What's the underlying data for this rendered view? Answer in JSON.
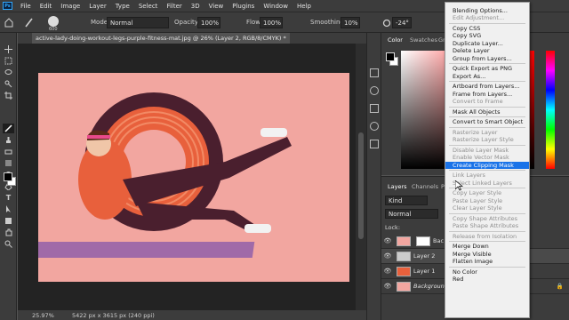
{
  "menubar": {
    "items": [
      "File",
      "Edit",
      "Image",
      "Layer",
      "Type",
      "Select",
      "Filter",
      "3D",
      "View",
      "Plugins",
      "Window",
      "Help"
    ]
  },
  "options": {
    "brush_size": "600",
    "mode_label": "Mode:",
    "mode_value": "Normal",
    "opacity_label": "Opacity:",
    "opacity_value": "100%",
    "flow_label": "Flow:",
    "flow_value": "100%",
    "smoothing_label": "Smoothing:",
    "smoothing_value": "10%",
    "angle_value": "-24°"
  },
  "document": {
    "tab_title": "active-lady-doing-workout-legs-purple-fitness-mat.jpg @ 26% (Layer 2, RGB/8/CMYK) *",
    "zoom": "25.97%",
    "dimensions": "5422 px x 3615 px (240 ppi)"
  },
  "color_panel": {
    "tabs": [
      "Color",
      "Swatches",
      "Gr"
    ]
  },
  "layers_panel": {
    "tabs": [
      "Layers",
      "Channels",
      "Pa"
    ],
    "kind_label": "Kind",
    "blend_mode": "Normal",
    "lock_label": "Lock:",
    "layers": [
      {
        "name": "Bac",
        "selected": false
      },
      {
        "name": "Layer 2",
        "selected": true
      },
      {
        "name": "Layer 1",
        "selected": false
      },
      {
        "name": "Background",
        "selected": false
      }
    ]
  },
  "context_menu": {
    "items": [
      {
        "label": "Blending Options...",
        "disabled": false
      },
      {
        "label": "Edit Adjustment...",
        "disabled": true
      },
      {
        "sep": true
      },
      {
        "label": "Copy CSS",
        "disabled": false
      },
      {
        "label": "Copy SVG",
        "disabled": false
      },
      {
        "label": "Duplicate Layer...",
        "disabled": false
      },
      {
        "label": "Delete Layer",
        "disabled": false
      },
      {
        "label": "Group from Layers...",
        "disabled": false
      },
      {
        "sep": true
      },
      {
        "label": "Quick Export as PNG",
        "disabled": false
      },
      {
        "label": "Export As...",
        "disabled": false
      },
      {
        "sep": true
      },
      {
        "label": "Artboard from Layers...",
        "disabled": false
      },
      {
        "label": "Frame from Layers...",
        "disabled": false
      },
      {
        "label": "Convert to Frame",
        "disabled": true
      },
      {
        "sep": true
      },
      {
        "label": "Mask All Objects",
        "disabled": false
      },
      {
        "sep": true
      },
      {
        "label": "Convert to Smart Object",
        "disabled": false
      },
      {
        "sep": true
      },
      {
        "label": "Rasterize Layer",
        "disabled": true
      },
      {
        "label": "Rasterize Layer Style",
        "disabled": true
      },
      {
        "sep": true
      },
      {
        "label": "Disable Layer Mask",
        "disabled": true
      },
      {
        "label": "Enable Vector Mask",
        "disabled": true
      },
      {
        "label": "Create Clipping Mask",
        "disabled": false,
        "highlighted": true
      },
      {
        "sep": true
      },
      {
        "label": "Link Layers",
        "disabled": true
      },
      {
        "label": "Select Linked Layers",
        "disabled": true
      },
      {
        "sep": true
      },
      {
        "label": "Copy Layer Style",
        "disabled": true
      },
      {
        "label": "Paste Layer Style",
        "disabled": true
      },
      {
        "label": "Clear Layer Style",
        "disabled": true
      },
      {
        "sep": true
      },
      {
        "label": "Copy Shape Attributes",
        "disabled": true
      },
      {
        "label": "Paste Shape Attributes",
        "disabled": true
      },
      {
        "sep": true
      },
      {
        "label": "Release from Isolation",
        "disabled": true
      },
      {
        "sep": true
      },
      {
        "label": "Merge Down",
        "disabled": false
      },
      {
        "label": "Merge Visible",
        "disabled": false
      },
      {
        "label": "Flatten Image",
        "disabled": false
      },
      {
        "sep": true
      },
      {
        "label": "No Color",
        "disabled": false
      },
      {
        "label": "Red",
        "disabled": false
      }
    ]
  },
  "colors": {
    "accent": "#1a73e8",
    "canvas_bg": "#f2a6a0",
    "ring": "#e8603c",
    "ring_dark": "#4a1f2e",
    "mat": "#a06aa8"
  }
}
